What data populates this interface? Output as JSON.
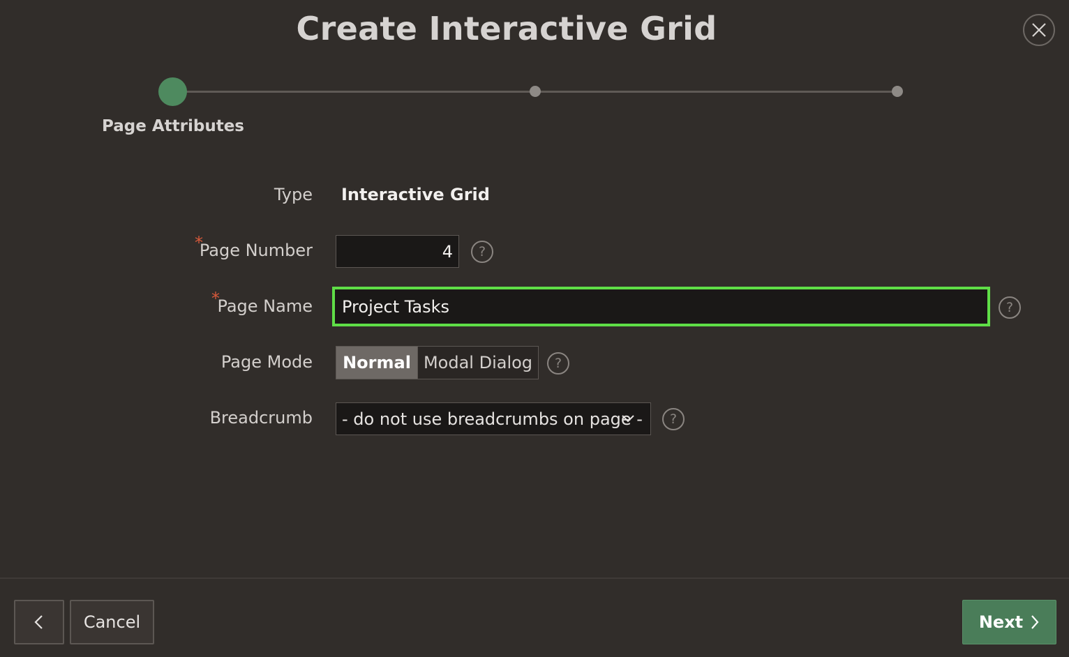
{
  "dialog": {
    "title": "Create Interactive Grid",
    "close_icon": "close-icon"
  },
  "wizard": {
    "steps": [
      {
        "label": "Page Attributes",
        "state": "active"
      },
      {
        "label": "",
        "state": "pending"
      },
      {
        "label": "",
        "state": "pending"
      }
    ],
    "active_color": "#4e8a5f"
  },
  "form": {
    "type": {
      "label": "Type",
      "value": "Interactive Grid"
    },
    "page_number": {
      "label": "Page Number",
      "required_mark": "*",
      "value": "4"
    },
    "page_name": {
      "label": "Page Name",
      "required_mark": "*",
      "value": "Project Tasks",
      "focus_color": "#5fde47"
    },
    "page_mode": {
      "label": "Page Mode",
      "options": [
        "Normal",
        "Modal Dialog"
      ],
      "selected": "Normal"
    },
    "breadcrumb": {
      "label": "Breadcrumb",
      "selected": "- do not use breadcrumbs on page -"
    },
    "help_glyph": "?"
  },
  "footer": {
    "back_icon": "chevron-left-icon",
    "cancel_label": "Cancel",
    "next_label": "Next",
    "next_icon": "chevron-right-icon",
    "next_color": "#4a7d59"
  }
}
